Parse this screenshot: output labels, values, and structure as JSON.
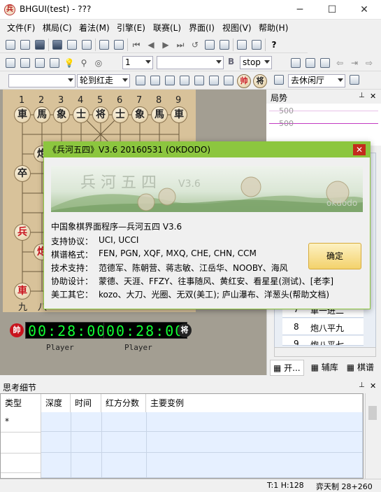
{
  "window": {
    "title": "BHGUI(test) - ???",
    "icon_char": "兵",
    "minimize": "─",
    "maximize": "☐",
    "close": "✕"
  },
  "menu": [
    "文件(F)",
    "棋局(C)",
    "着法(M)",
    "引擎(E)",
    "联赛(L)",
    "界面(I)",
    "视图(V)",
    "帮助(H)"
  ],
  "toolbar2": {
    "move_combo": "1",
    "engine_combo": "stop"
  },
  "toolbar3": {
    "mode_combo": "轮到红走",
    "opening_combo": "去休闲厅"
  },
  "board": {
    "file_numbers_top": [
      "1",
      "2",
      "3",
      "4",
      "5",
      "6",
      "7",
      "8",
      "9"
    ],
    "file_numbers_bottom_visible": [
      "九",
      "八"
    ],
    "black_back_row": [
      "車",
      "馬",
      "象",
      "士",
      "将",
      "士",
      "象",
      "馬",
      "車"
    ],
    "black_cannon": "炮",
    "black_pawn": "卒",
    "red_pawn": "兵",
    "red_cannon": "炮",
    "red_chariot": "車"
  },
  "clocks": {
    "red_badge": "帥",
    "red_time": "00:28:00",
    "red_player": "Player",
    "black_badge": "将",
    "black_time": "00:28:00",
    "black_player": "Player"
  },
  "trend": {
    "title": "局势",
    "pin": "⊥",
    "close": "✕",
    "ticks": [
      "500",
      "500"
    ]
  },
  "dialog": {
    "title": "《兵河五四》V3.6 20160531 (OKDODO)",
    "close": "✕",
    "banner_text": "兵  河  五  四",
    "banner_version": "V3.6",
    "banner_watermark": "okdodo",
    "heading": "中国象棋界面程序—兵河五四 V3.6",
    "rows": [
      {
        "label": "支持协议：",
        "value": "UCI, UCCI"
      },
      {
        "label": "棋谱格式：",
        "value": "FEN, PGN, XQF, MXQ, CHE, CHN, CCM"
      },
      {
        "label": "技术支持：",
        "value": "范德军、陈朝营、蒋志敏、江岳华、NOOBY、海风"
      },
      {
        "label": "协助设计：",
        "value": "蒙德、天涯、FFZY、往事随风、黄红安、看星星(测试)、[老李]"
      },
      {
        "label": "美工其它：",
        "value": "kozo、大刀、光圈、无双(美工); 庐山瀑布、洋葱头(帮助文档)"
      }
    ],
    "ok_button": "确定"
  },
  "move_list": [
    {
      "no": "7",
      "move": "車一进二"
    },
    {
      "no": "8",
      "move": "炮八平九"
    },
    {
      "no": "9",
      "move": "炮八平七"
    }
  ],
  "right_tabs": [
    "开...",
    "辅库",
    "棋谱"
  ],
  "think": {
    "title": "思考细节",
    "pin": "⊥",
    "close": "✕",
    "columns": [
      "类型",
      "深度",
      "时间",
      "红方分数",
      "主要变例"
    ],
    "first_row_marker": "*"
  },
  "status": {
    "pos": "T:1 H:128",
    "mode": "弈天制 28+260"
  }
}
